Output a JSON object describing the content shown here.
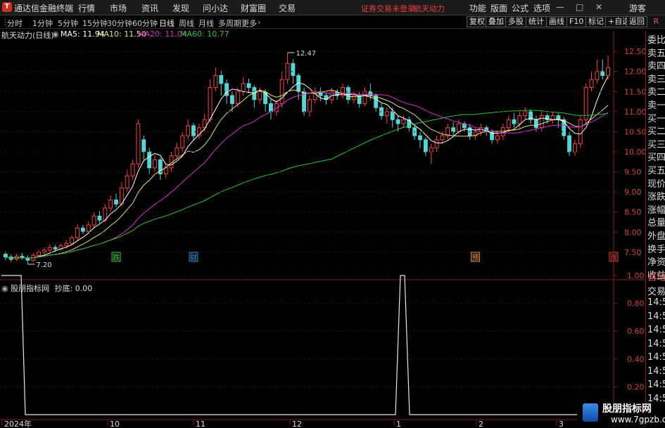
{
  "app": {
    "title": "通达信金融终端",
    "menus": [
      "行情",
      "市场",
      "资讯",
      "发现",
      "问小达",
      "财富圈",
      "交易"
    ],
    "notice": "证券交易未登录",
    "stock_link": "航天动力",
    "right_menus": [
      "功能",
      "版面",
      "公式",
      "选项"
    ],
    "guest": "游客"
  },
  "toolbar": {
    "periods": [
      "分时",
      "1分钟",
      "5分钟",
      "15分钟",
      "30分钟",
      "60分钟",
      "日线",
      "周线",
      "月线",
      "多周期",
      "更多"
    ],
    "active_period": "日线",
    "right_buttons": [
      "复权",
      "叠加",
      "多股",
      "统计",
      "画线",
      "F10",
      "标记",
      "+自选",
      "返回"
    ],
    "corner": "R"
  },
  "chart_info": {
    "name": "航天动力(日线)",
    "ma5": "MA5: 11.94",
    "ma10": "MA10: 11.50",
    "ma20": "MA20: 11.04",
    "ma60": "MA60: 10.77",
    "colors": {
      "ma5": "#ffffff",
      "ma10": "#e8e070",
      "ma20": "#d030d0",
      "ma60": "#30c030"
    }
  },
  "indicator": {
    "label": "股朋指标网",
    "value": "抄底: 0.00"
  },
  "right_panel": {
    "items": [
      "委比",
      "卖五",
      "卖四",
      "卖三",
      "卖二",
      "卖一",
      "买一",
      "买二",
      "买三",
      "买四",
      "买五",
      "现价",
      "涨跌",
      "涨幅",
      "总量",
      "外盘",
      "换手",
      "净资",
      "收益"
    ],
    "lower_items": [
      "自动",
      "交易",
      "14:56",
      "14:56",
      "14:56",
      "14:56",
      "14:56",
      "14:56",
      "14:56",
      "14:56"
    ]
  },
  "chart_data": {
    "type": "candlestick",
    "y_ticks": [
      "12.50",
      "12.00",
      "11.50",
      "11.00",
      "10.50",
      "10.00",
      "9.50",
      "9.00",
      "8.50",
      "8.00",
      "7.50"
    ],
    "ylim": [
      7.2,
      12.8
    ],
    "high_label": "12.47",
    "low_label": "7.20",
    "event_markers": [
      {
        "label": "跌",
        "color": "#30c030"
      },
      {
        "label": "财",
        "color": "#3080e0"
      },
      {
        "label": "预",
        "color": "#e08a30"
      },
      {
        "label": "涨",
        "color": "#e03030"
      }
    ],
    "x_labels": [
      "2024年",
      "10",
      "11",
      "12",
      "1",
      "2",
      "3"
    ],
    "candles": [
      [
        7.45,
        7.38,
        7.52,
        7.3
      ],
      [
        7.38,
        7.32,
        7.44,
        7.26
      ],
      [
        7.33,
        7.4,
        7.46,
        7.28
      ],
      [
        7.4,
        7.36,
        7.48,
        7.32
      ],
      [
        7.36,
        7.3,
        7.42,
        7.2
      ],
      [
        7.3,
        7.42,
        7.48,
        7.26
      ],
      [
        7.42,
        7.5,
        7.56,
        7.38
      ],
      [
        7.5,
        7.55,
        7.62,
        7.44
      ],
      [
        7.55,
        7.62,
        7.7,
        7.5
      ],
      [
        7.62,
        7.58,
        7.68,
        7.52
      ],
      [
        7.58,
        7.66,
        7.72,
        7.54
      ],
      [
        7.66,
        7.72,
        7.8,
        7.6
      ],
      [
        7.72,
        7.86,
        7.92,
        7.68
      ],
      [
        7.86,
        8.1,
        8.2,
        7.8
      ],
      [
        8.1,
        8.02,
        8.18,
        7.95
      ],
      [
        8.02,
        8.18,
        8.26,
        7.98
      ],
      [
        8.18,
        8.4,
        8.48,
        8.12
      ],
      [
        8.4,
        8.3,
        8.52,
        8.22
      ],
      [
        8.3,
        8.6,
        8.7,
        8.25
      ],
      [
        8.6,
        8.8,
        8.92,
        8.5
      ],
      [
        8.8,
        8.7,
        8.96,
        8.62
      ],
      [
        8.7,
        9.1,
        9.25,
        8.65
      ],
      [
        9.1,
        9.4,
        9.55,
        9.0
      ],
      [
        9.4,
        9.7,
        9.8,
        9.3
      ],
      [
        9.7,
        10.7,
        10.8,
        9.6
      ],
      [
        10.3,
        10.0,
        10.4,
        9.8
      ],
      [
        10.0,
        9.6,
        10.1,
        9.45
      ],
      [
        9.6,
        9.8,
        9.92,
        9.5
      ],
      [
        9.8,
        9.45,
        9.86,
        9.3
      ],
      [
        9.45,
        9.6,
        9.7,
        9.35
      ],
      [
        9.6,
        9.9,
        10.0,
        9.5
      ],
      [
        9.9,
        10.1,
        10.22,
        9.8
      ],
      [
        10.1,
        10.4,
        10.5,
        10.0
      ],
      [
        10.4,
        10.65,
        10.8,
        10.3
      ],
      [
        10.65,
        10.4,
        10.72,
        10.3
      ],
      [
        10.4,
        10.6,
        10.7,
        10.32
      ],
      [
        10.6,
        10.8,
        10.94,
        10.5
      ],
      [
        10.8,
        11.6,
        11.8,
        10.74
      ],
      [
        11.6,
        11.9,
        12.1,
        11.5
      ],
      [
        11.9,
        11.7,
        12.02,
        11.4
      ],
      [
        11.7,
        11.4,
        11.8,
        11.2
      ],
      [
        11.4,
        11.2,
        11.5,
        11.0
      ],
      [
        11.2,
        11.5,
        11.6,
        11.1
      ],
      [
        11.5,
        11.7,
        11.86,
        11.4
      ],
      [
        11.7,
        11.6,
        11.82,
        11.46
      ],
      [
        11.6,
        11.3,
        11.66,
        11.1
      ],
      [
        11.3,
        11.5,
        11.6,
        11.2
      ],
      [
        11.5,
        11.2,
        11.56,
        11.0
      ],
      [
        11.2,
        11.0,
        11.3,
        10.8
      ],
      [
        11.0,
        11.2,
        11.3,
        10.9
      ],
      [
        11.2,
        11.8,
        12.0,
        11.1
      ],
      [
        11.8,
        12.2,
        12.47,
        11.7
      ],
      [
        12.2,
        11.9,
        12.3,
        11.7
      ],
      [
        11.9,
        11.5,
        11.96,
        11.3
      ],
      [
        11.5,
        11.0,
        11.6,
        10.9
      ],
      [
        11.0,
        11.3,
        11.4,
        10.88
      ],
      [
        11.3,
        11.5,
        11.6,
        11.2
      ],
      [
        11.5,
        11.4,
        11.6,
        11.26
      ],
      [
        11.4,
        11.3,
        11.5,
        11.18
      ],
      [
        11.3,
        11.5,
        11.6,
        11.2
      ],
      [
        11.5,
        11.4,
        11.56,
        11.3
      ],
      [
        11.4,
        11.6,
        11.7,
        11.32
      ],
      [
        11.6,
        11.3,
        11.66,
        11.2
      ],
      [
        11.3,
        11.4,
        11.5,
        11.2
      ],
      [
        11.4,
        11.2,
        11.48,
        11.1
      ],
      [
        11.2,
        11.5,
        11.6,
        11.14
      ],
      [
        11.5,
        11.4,
        11.7,
        11.3
      ],
      [
        11.4,
        11.1,
        11.46,
        11.0
      ],
      [
        11.1,
        10.9,
        11.2,
        10.8
      ],
      [
        10.9,
        11.0,
        11.1,
        10.7
      ],
      [
        11.0,
        10.8,
        11.1,
        10.6
      ],
      [
        10.8,
        10.7,
        10.9,
        10.5
      ],
      [
        10.7,
        10.8,
        10.9,
        10.6
      ],
      [
        10.8,
        10.6,
        10.88,
        10.5
      ],
      [
        10.6,
        10.4,
        10.7,
        10.3
      ],
      [
        10.4,
        10.3,
        10.5,
        10.1
      ],
      [
        10.3,
        10.0,
        10.36,
        9.9
      ],
      [
        10.0,
        10.1,
        10.2,
        9.7
      ],
      [
        10.1,
        10.3,
        10.4,
        10.0
      ],
      [
        10.3,
        10.4,
        10.5,
        10.2
      ],
      [
        10.4,
        10.6,
        10.7,
        10.3
      ],
      [
        10.6,
        10.5,
        10.74,
        10.4
      ],
      [
        10.5,
        10.7,
        10.8,
        10.44
      ],
      [
        10.7,
        10.6,
        10.76,
        10.5
      ],
      [
        10.6,
        10.4,
        10.7,
        10.3
      ],
      [
        10.4,
        10.5,
        10.6,
        10.3
      ],
      [
        10.5,
        10.6,
        10.7,
        10.4
      ],
      [
        10.6,
        10.5,
        10.66,
        10.4
      ],
      [
        10.5,
        10.3,
        10.56,
        10.2
      ],
      [
        10.3,
        10.4,
        10.5,
        10.2
      ],
      [
        10.4,
        10.6,
        10.7,
        10.3
      ],
      [
        10.6,
        10.8,
        10.9,
        10.5
      ],
      [
        10.8,
        10.7,
        10.96,
        10.6
      ],
      [
        10.7,
        10.9,
        11.04,
        10.6
      ],
      [
        10.9,
        11.0,
        11.1,
        10.8
      ],
      [
        11.0,
        10.8,
        11.06,
        10.7
      ],
      [
        10.8,
        10.6,
        10.9,
        10.5
      ],
      [
        10.6,
        10.9,
        11.0,
        10.5
      ],
      [
        10.9,
        10.8,
        10.96,
        10.7
      ],
      [
        10.8,
        10.9,
        11.0,
        10.7
      ],
      [
        10.9,
        10.8,
        10.96,
        10.6
      ],
      [
        10.8,
        10.4,
        10.86,
        10.3
      ],
      [
        10.4,
        10.0,
        10.5,
        9.9
      ],
      [
        10.0,
        10.2,
        10.3,
        9.9
      ],
      [
        10.2,
        10.8,
        10.9,
        10.1
      ],
      [
        10.8,
        11.6,
        11.7,
        10.7
      ],
      [
        11.6,
        11.8,
        12.0,
        11.5
      ],
      [
        11.8,
        12.0,
        12.3,
        11.7
      ],
      [
        12.0,
        11.9,
        12.3,
        11.8
      ],
      [
        11.9,
        12.1,
        12.4,
        11.8
      ]
    ]
  }
}
